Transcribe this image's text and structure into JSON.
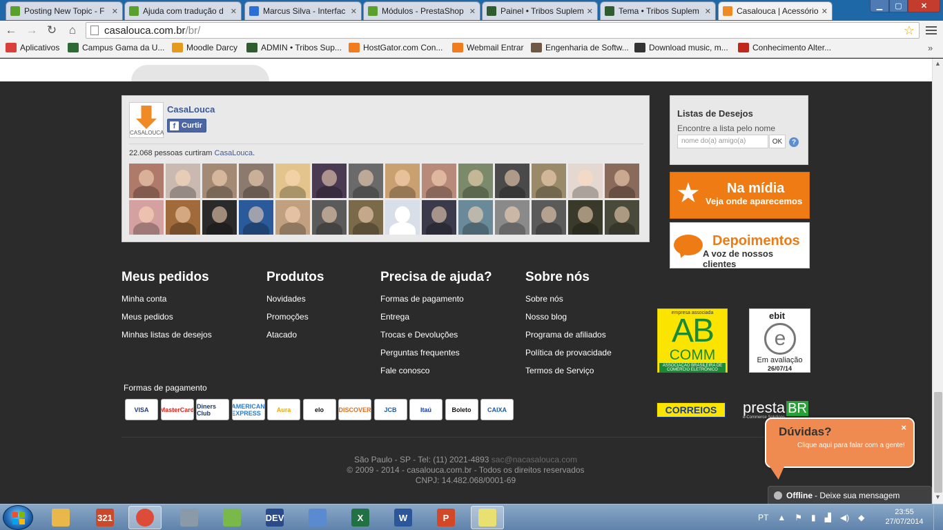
{
  "browser": {
    "tabs": [
      {
        "label": "Posting New Topic - F",
        "color": "#5aa02c",
        "active": false
      },
      {
        "label": "Ajuda com tradução d",
        "color": "#5aa02c",
        "active": false
      },
      {
        "label": "Marcus Silva - Interfac",
        "color": "#2a6fd6",
        "active": false
      },
      {
        "label": "Módulos - PrestaShop",
        "color": "#5aa02c",
        "active": false
      },
      {
        "label": "Painel • Tribos Suplem",
        "color": "#2f5d2f",
        "active": false
      },
      {
        "label": "Tema • Tribos Suplem",
        "color": "#2f5d2f",
        "active": false
      },
      {
        "label": "Casalouca | Acessórios",
        "color": "#f08a24",
        "active": true
      }
    ],
    "url_host": "casalouca.com.br",
    "url_path": "/br/",
    "bookmarks": [
      {
        "label": "Aplicativos",
        "color": "#d9403a"
      },
      {
        "label": "Campus Gama da U...",
        "color": "#2e6b34"
      },
      {
        "label": "Moodle Darcy",
        "color": "#e49a1b"
      },
      {
        "label": "ADMIN • Tribos Sup...",
        "color": "#2f5d2f"
      },
      {
        "label": "HostGator.com Con...",
        "color": "#f07c1f"
      },
      {
        "label": "Webmail Entrar",
        "color": "#f07c1f"
      },
      {
        "label": "Engenharia de Softw...",
        "color": "#6e5a44"
      },
      {
        "label": "Download music, m...",
        "color": "#333333"
      },
      {
        "label": "Conhecimento Alter...",
        "color": "#c0281e"
      }
    ],
    "bookmarks_more": "»"
  },
  "facebook": {
    "page_name": "CasaLouca",
    "logo_text": "CASALOUCA",
    "like_label": "Curtir",
    "like_count_text": "22.068 pessoas curtiram",
    "like_count_page": "CasaLouca",
    "like_count_suffix": ".",
    "faces": [
      "#b07a6a",
      "#c9b9b0",
      "#a48a74",
      "#8d7a6e",
      "#e2c48c",
      "#4a3a52",
      "#6a6a6a",
      "#c9a070",
      "#b88a7a",
      "#7a8a6a",
      "#4a4a4a",
      "#9a8a6a",
      "#e4d8d0",
      "#8a6a5a",
      "#d4a0a0",
      "#a06a3a",
      "#2a2a2a",
      "#2a5a9a",
      "#c0a080",
      "#5a5a5a",
      "#7a6a4a",
      "blank",
      "#3a3a4a",
      "#6a8a9a",
      "#8a8a8a",
      "#5a5a5a",
      "#3a3a2a",
      "#4a4a3a"
    ]
  },
  "wishlist": {
    "title": "Listas de Desejos",
    "subtitle": "Encontre a lista pelo nome",
    "placeholder": "nome do(a) amigo(a)",
    "ok_label": "OK",
    "help_label": "?"
  },
  "banners": {
    "midia_title": "Na mídia",
    "midia_sub": "Veja onde aparecemos",
    "dep_title": "Depoimentos",
    "dep_sub": "A voz de nossos clientes"
  },
  "footer": {
    "columns": [
      {
        "title": "Meus pedidos",
        "links": [
          "Minha conta",
          "Meus pedidos",
          "Minhas listas de desejos"
        ]
      },
      {
        "title": "Produtos",
        "links": [
          "Novidades",
          "Promoções",
          "Atacado"
        ]
      },
      {
        "title": "Precisa de ajuda?",
        "links": [
          "Formas de pagamento",
          "Entrega",
          "Trocas e Devoluções",
          "Perguntas frequentes",
          "Fale conosco"
        ]
      },
      {
        "title": "Sobre nós",
        "links": [
          "Sobre nós",
          "Nosso blog",
          "Programa de afiliados",
          "Política de provacidade",
          "Termos de Serviço"
        ]
      }
    ],
    "payment_title": "Formas de pagamento",
    "payment_cards": [
      {
        "label": "VISA",
        "color": "#1a3a8a"
      },
      {
        "label": "MasterCard",
        "color": "#e2231a"
      },
      {
        "label": "Diners Club",
        "color": "#1a3a6a"
      },
      {
        "label": "AMERICAN EXPRESS",
        "color": "#2a7ac8"
      },
      {
        "label": "Aura",
        "color": "#f0a800"
      },
      {
        "label": "elo",
        "color": "#111111"
      },
      {
        "label": "DISCOVER",
        "color": "#e07020"
      },
      {
        "label": "JCB",
        "color": "#1a5aa8"
      },
      {
        "label": "Itaú",
        "color": "#1a3aa8"
      },
      {
        "label": "Boleto",
        "color": "#111111"
      },
      {
        "label": "CAIXA",
        "color": "#1a5aa8"
      }
    ],
    "abcomm": {
      "top": "empresa associada",
      "big": "AB",
      "mid": "COMM",
      "bottom": "ASSOCIAÇÃO BRASILEIRA DE COMÉRCIO ELETRÔNICO"
    },
    "ebit": {
      "brand": "ebit",
      "letter": "e",
      "status": "Em avaliação",
      "date": "26/07/14"
    },
    "correios": "CORREIOS",
    "presta": {
      "name": "presta",
      "br": "BR",
      "sub": "e-Commerce Solutions"
    },
    "address": "São Paulo - SP - Tel: (11) 2021-4893",
    "email": "sac@nacasalouca.com",
    "copyright": "© 2009 - 2014 - casalouca.com.br - Todos os direitos reservados",
    "cnpj": "CNPJ: 14.482.068/0001-69"
  },
  "chat": {
    "title": "Dúvidas?",
    "subtitle": "Clique aqui para falar com a gente!",
    "close": "×",
    "offline_label": "Offline",
    "offline_msg": "- Deixe sua mensagem"
  },
  "taskbar": {
    "apps": [
      {
        "name": "explorer",
        "color": "#e8b84a",
        "glyph": ""
      },
      {
        "name": "media-player",
        "color": "#c84a2a",
        "glyph": "321"
      },
      {
        "name": "chrome",
        "color": "#dd4b39",
        "glyph": ""
      },
      {
        "name": "calculator",
        "color": "#8a9aa8",
        "glyph": ""
      },
      {
        "name": "notepad",
        "color": "#7ab84a",
        "glyph": ""
      },
      {
        "name": "dev-cpp",
        "color": "#2a4a8a",
        "glyph": "DEV"
      },
      {
        "name": "virtualbox",
        "color": "#5a8ad0",
        "glyph": ""
      },
      {
        "name": "excel",
        "color": "#207245",
        "glyph": "X"
      },
      {
        "name": "word",
        "color": "#2b579a",
        "glyph": "W"
      },
      {
        "name": "powerpoint",
        "color": "#d24726",
        "glyph": "P"
      },
      {
        "name": "sticky-notes",
        "color": "#e8e070",
        "glyph": ""
      }
    ],
    "language": "PT",
    "time": "23:55",
    "date": "27/07/2014"
  }
}
